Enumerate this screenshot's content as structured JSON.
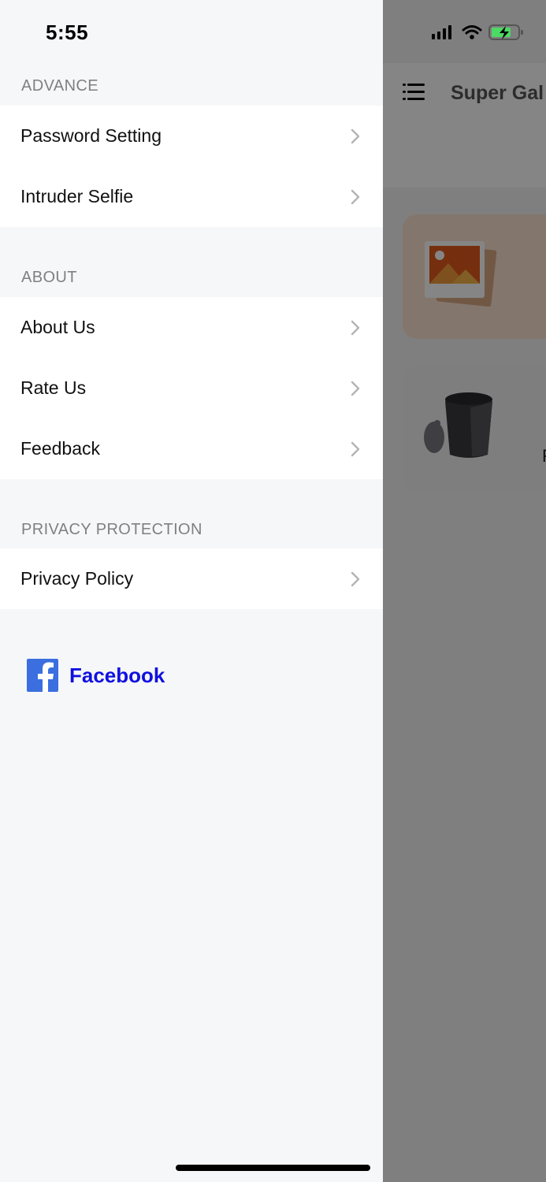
{
  "status_bar": {
    "time": "5:55"
  },
  "background_app": {
    "title": "Super Gal",
    "card_label": "F"
  },
  "drawer": {
    "sections": [
      {
        "header": "ADVANCE",
        "items": [
          {
            "label": "Password Setting"
          },
          {
            "label": "Intruder Selfie"
          }
        ]
      },
      {
        "header": "ABOUT",
        "items": [
          {
            "label": "About Us"
          },
          {
            "label": "Rate Us"
          },
          {
            "label": "Feedback"
          }
        ]
      },
      {
        "header": "PRIVACY PROTECTION",
        "items": [
          {
            "label": "Privacy Policy"
          }
        ]
      }
    ],
    "facebook": {
      "label": "Facebook",
      "icon": "facebook-icon"
    }
  },
  "colors": {
    "link_blue": "#1010e0",
    "facebook_brand": "#3b6fe0",
    "battery_green": "#4cd964"
  }
}
